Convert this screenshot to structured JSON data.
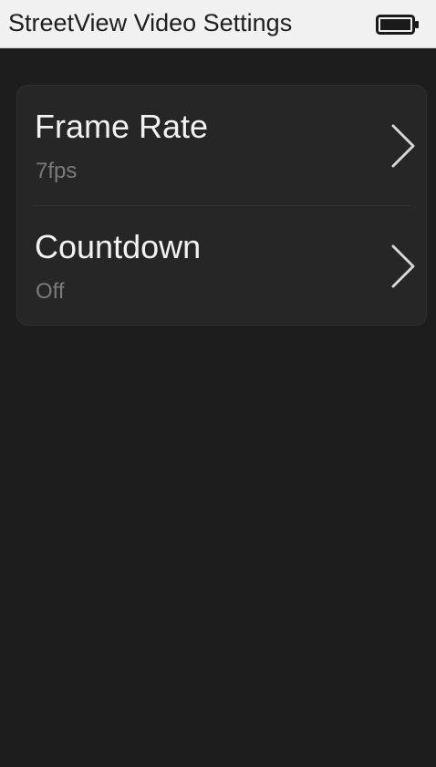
{
  "header": {
    "title": "StreetView Video Settings",
    "battery_icon": "battery-full-icon"
  },
  "settings": {
    "items": [
      {
        "label": "Frame Rate",
        "value": "7fps",
        "icon": "chevron-right-icon"
      },
      {
        "label": "Countdown",
        "value": "Off",
        "icon": "chevron-right-icon"
      }
    ]
  },
  "colors": {
    "header_background": "#f1f1f1",
    "screen_background": "#1d1d1d",
    "card_background": "#262626",
    "label_text": "#f2f2f2",
    "value_text": "#7a7a7a"
  }
}
